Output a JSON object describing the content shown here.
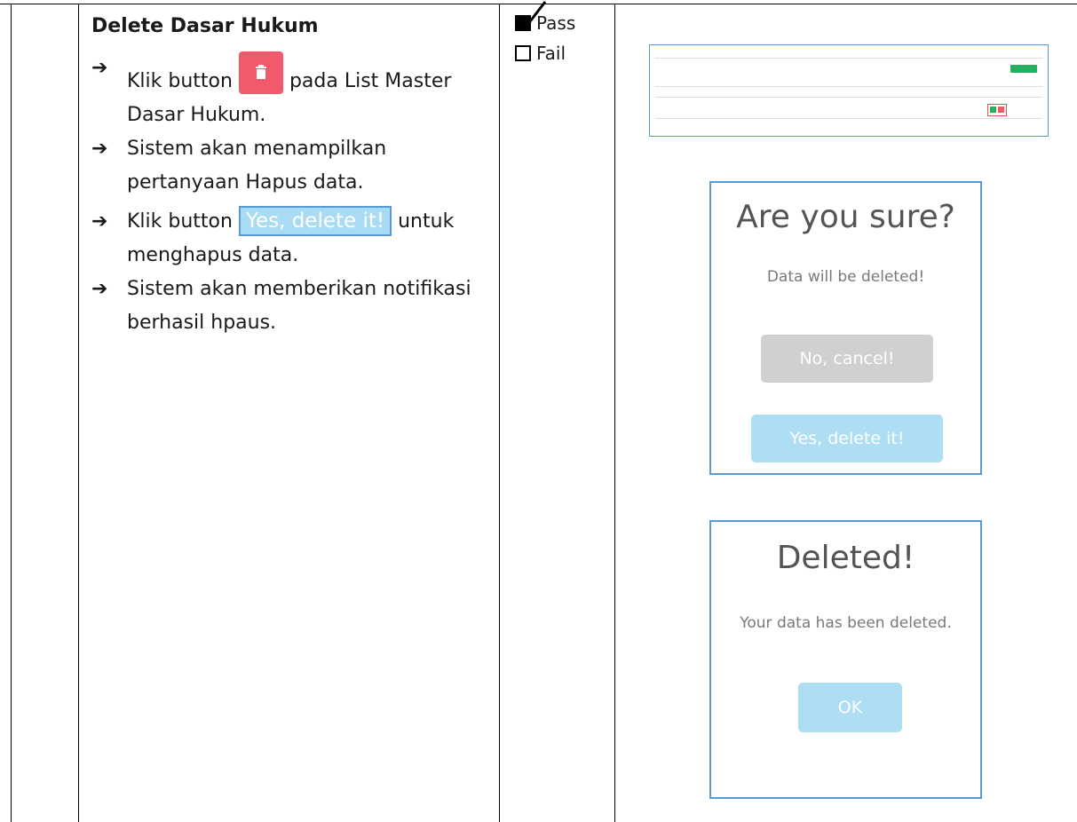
{
  "step": {
    "title": "Delete Dasar Hukum",
    "items": [
      {
        "before": "Klik button",
        "after": "pada List Master Dasar Hukum."
      },
      {
        "text": "Sistem akan menampilkan pertanyaan Hapus data."
      },
      {
        "before": "Klik button",
        "inline_button": "Yes, delete it!",
        "after": "untuk menghapus data."
      },
      {
        "text": "Sistem akan memberikan notifikasi berhasil hpaus."
      }
    ]
  },
  "result": {
    "pass_label": "Pass",
    "fail_label": "Fail",
    "pass_checked": true
  },
  "confirm_dialog": {
    "title": "Are you sure?",
    "text": "Data will be deleted!",
    "cancel_label": "No, cancel!",
    "confirm_label": "Yes, delete it!"
  },
  "success_dialog": {
    "title": "Deleted!",
    "text": "Your data has been deleted.",
    "ok_label": "OK"
  },
  "colors": {
    "delete_button": "#f05a6a",
    "confirm_button": "#aedef4",
    "cancel_button": "#d0d0d0",
    "dialog_border": "#5b9bd5"
  }
}
